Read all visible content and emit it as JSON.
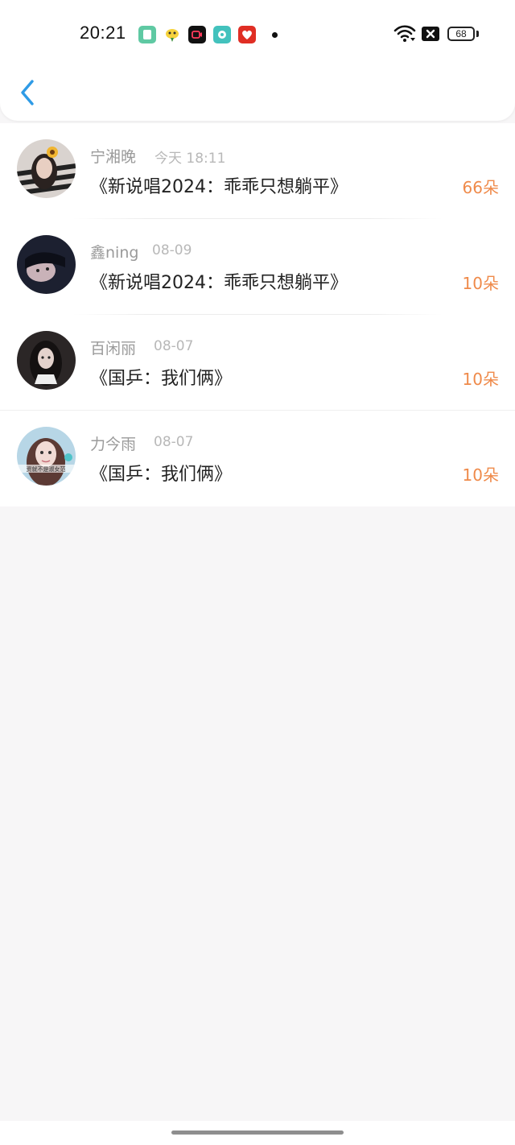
{
  "status": {
    "time": "20:21",
    "battery": "68",
    "app_icons": [
      "notes-app-icon",
      "bird-app-icon",
      "video-app-icon",
      "chat-app-icon",
      "pinduoduo-app-icon"
    ]
  },
  "colors": {
    "accent_back": "#2f9be6",
    "gift_orange": "#ef8a4a",
    "name_gray": "#9a9a9a",
    "date_gray": "#b8b8b8"
  },
  "records": [
    {
      "name": "宁湘晚",
      "date": "今天 18:11",
      "song": "《新说唱2024：乖乖只想躺平》",
      "gift": "66朵"
    },
    {
      "name": "鑫ning",
      "date": "08-09",
      "song": "《新说唱2024：乖乖只想躺平》",
      "gift": "10朵"
    },
    {
      "name": "百闲丽",
      "date": "08-07",
      "song": "《国乒：我们俩》",
      "gift": "10朵"
    },
    {
      "name": "力今雨",
      "date": "08-07",
      "song": "《国乒：我们俩》",
      "gift": "10朵"
    }
  ],
  "avatar_caption": "资就不是淑女范"
}
